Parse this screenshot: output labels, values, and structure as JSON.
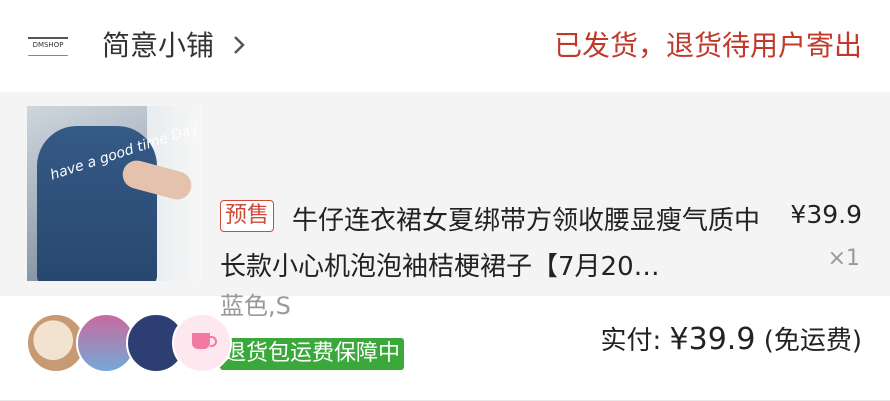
{
  "header": {
    "shop_name": "简意小铺",
    "status": "已发货，退货待用户寄出",
    "logo_text": "DMSHOP"
  },
  "item": {
    "presale_badge": "预售",
    "title": "牛仔连衣裙女夏绑带方领收腰显瘦气质中长款小心机泡泡袖桔梗裙子【7月20…",
    "price": "¥39.9",
    "quantity": "×1",
    "variant": "蓝色,S",
    "guarantee": "退货包运费保障中",
    "image_text": "have a good time Day"
  },
  "footer": {
    "paid_label": "实付:",
    "paid_amount": "¥39.9",
    "shipping_note": "(免运费)"
  },
  "colors": {
    "status": "#c0392b",
    "presale": "#d04a3a",
    "guarantee_bg": "#3aa83a"
  }
}
